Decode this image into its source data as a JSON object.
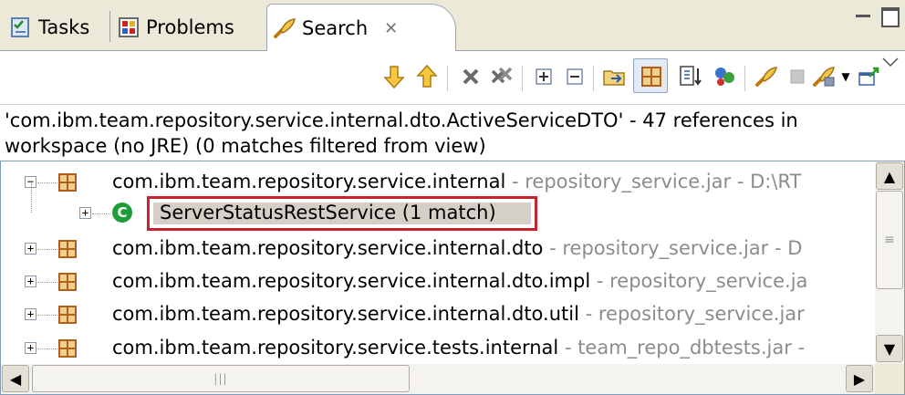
{
  "tabs": [
    {
      "label": "Tasks",
      "icon": "tasks-icon",
      "active": false
    },
    {
      "label": "Problems",
      "icon": "problems-icon",
      "active": false
    },
    {
      "label": "Search",
      "icon": "search-icon",
      "active": true,
      "close_glyph": "✕"
    }
  ],
  "window_controls": {
    "minimize": "minimize-icon",
    "maximize": "maximize-icon"
  },
  "toolbar_icons": [
    "next-match-icon",
    "previous-match-icon",
    "remove-selected-icon",
    "remove-all-icon",
    "expand-all-icon",
    "collapse-all-icon",
    "go-to-file-icon",
    "show-as-tree-icon",
    "show-as-list-icon",
    "cancel-search-icon",
    "previous-searches-icon",
    "stop-icon",
    "pin-icon",
    "dropdown-icon",
    "open-in-view-icon",
    "view-menu-icon"
  ],
  "search_label": {
    "line1": "'com.ibm.team.repository.service.internal.dto.ActiveServiceDTO' - 47 references in",
    "line2": "workspace (no JRE) (0 matches filtered from view)"
  },
  "tree": [
    {
      "name": "com.ibm.team.repository.service.internal",
      "detail": " - repository_service.jar - D:\\RT",
      "expanded": true
    },
    {
      "name": "ServerStatusRestService (1 match)",
      "detail": "",
      "selected": true,
      "type": "class"
    },
    {
      "name": "com.ibm.team.repository.service.internal.dto",
      "detail": " - repository_service.jar - D",
      "expanded": false
    },
    {
      "name": "com.ibm.team.repository.service.internal.dto.impl",
      "detail": " - repository_service.ja",
      "expanded": false
    },
    {
      "name": "com.ibm.team.repository.service.internal.dto.util",
      "detail": " - repository_service.jar",
      "expanded": false
    },
    {
      "name": "com.ibm.team.repository.service.tests.internal",
      "detail": " - team_repo_dbtests.jar -",
      "expanded": false
    }
  ],
  "scrollbars": {
    "grip_glyph": "|||",
    "v_grip_glyph": "≡",
    "up": "▲",
    "down": "▼",
    "left": "◀",
    "right": "▶"
  },
  "colors": {
    "selection_border": "#c8232c",
    "package_icon": "#b06018",
    "class_icon": "#1f9d3a",
    "detail_text": "#8c8c8c"
  }
}
